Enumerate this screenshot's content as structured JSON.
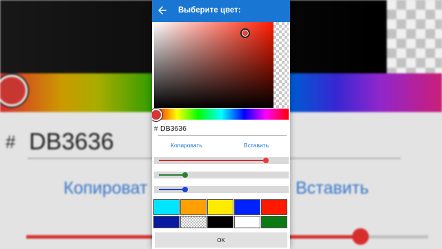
{
  "background_app": {
    "hash": "#",
    "hex_value": "DB3636",
    "copy_label": "Копироват",
    "paste_label": "Вставить"
  },
  "dialog": {
    "title": "Выберите цвет:",
    "back_icon": "arrow-left-icon",
    "selected_color": "#DB3636",
    "hash": "#",
    "hex_value": "DB3636",
    "copy_label": "Копировать",
    "paste_label": "Вставить",
    "sliders": [
      {
        "channel": "red",
        "value": 219,
        "max": 255,
        "color": "#e53935"
      },
      {
        "channel": "green",
        "value": 54,
        "max": 255,
        "color": "#2e7d32"
      },
      {
        "channel": "blue",
        "value": 54,
        "max": 255,
        "color": "#1e40d8"
      }
    ],
    "swatches": [
      {
        "color": "#00e5ff"
      },
      {
        "color": "#ffa000"
      },
      {
        "color": "#ffeb00"
      },
      {
        "color": "#0022ff"
      },
      {
        "color": "#ff1a00"
      },
      {
        "color": "#0a1aa0"
      },
      {
        "color": "transparent"
      },
      {
        "color": "#000000"
      },
      {
        "color": "#ffffff"
      },
      {
        "color": "#0c7a14"
      }
    ],
    "ok_label": "OK",
    "accent_color": "#1976d2"
  }
}
